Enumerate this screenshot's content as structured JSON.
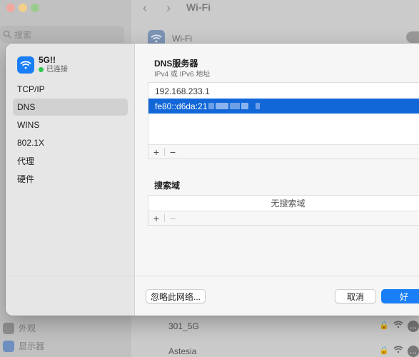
{
  "background": {
    "search_placeholder": "搜索",
    "title": "Wi-Fi",
    "wifi_label": "Wi-Fi",
    "sidebar_bottom": [
      {
        "label": "外观"
      },
      {
        "label": "显示器"
      }
    ],
    "networks": [
      {
        "name": "301_5G"
      },
      {
        "name": "Astesia"
      }
    ]
  },
  "dialog": {
    "network": {
      "name": "5G!!",
      "status": "已连接",
      "status_color": "#2fc750",
      "icon": "wifi-icon"
    },
    "menu": [
      {
        "label": "TCP/IP",
        "active": false
      },
      {
        "label": "DNS",
        "active": true
      },
      {
        "label": "WINS",
        "active": false
      },
      {
        "label": "802.1X",
        "active": false
      },
      {
        "label": "代理",
        "active": false
      },
      {
        "label": "硬件",
        "active": false
      }
    ],
    "dns": {
      "title": "DNS服务器",
      "subtitle": "IPv4 或 IPv6 地址",
      "servers": [
        {
          "value": "192.168.233.1",
          "selected": false
        },
        {
          "value": "fe80::d6da:21",
          "selected": true
        }
      ],
      "add_label": "+",
      "remove_label": "−"
    },
    "search_domains": {
      "title": "搜索域",
      "empty_text": "无搜索域",
      "add_label": "+",
      "remove_label": "−"
    },
    "buttons": {
      "forget": "忽略此网络...",
      "cancel": "取消",
      "ok": "好"
    },
    "accent_color": "#1a7ef7",
    "selection_color": "#1267d8"
  }
}
